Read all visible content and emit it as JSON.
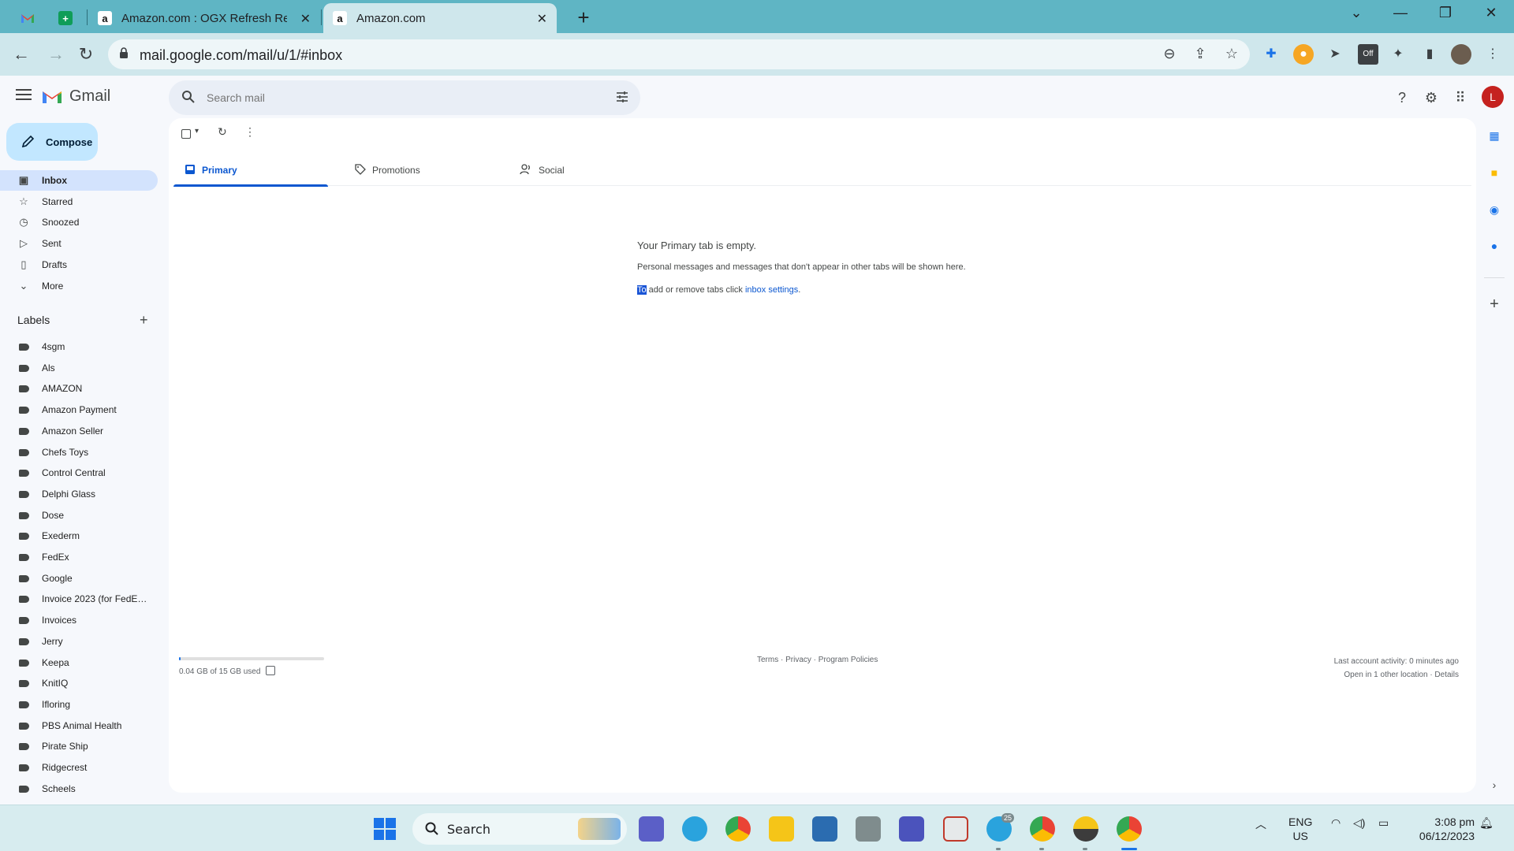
{
  "browser": {
    "tabs": [
      {
        "title": "",
        "favicon": "gmail-icon"
      },
      {
        "title": "",
        "favicon": "sheets-icon"
      },
      {
        "title": "Amazon.com : OGX Refresh Revi",
        "favicon": "amazon-icon"
      },
      {
        "title": "Amazon.com",
        "favicon": "amazon-icon"
      }
    ],
    "url": "mail.google.com/mail/u/1/#inbox"
  },
  "header": {
    "app_name": "Gmail",
    "search_placeholder": "Search mail",
    "avatar_initial": "L"
  },
  "sidebar": {
    "compose_label": "Compose",
    "items": [
      {
        "label": "Inbox",
        "icon": "inbox-icon",
        "active": true
      },
      {
        "label": "Starred",
        "icon": "star-icon"
      },
      {
        "label": "Snoozed",
        "icon": "clock-icon"
      },
      {
        "label": "Sent",
        "icon": "send-icon"
      },
      {
        "label": "Drafts",
        "icon": "draft-icon"
      },
      {
        "label": "More",
        "icon": "chevron-down-icon"
      }
    ],
    "labels_heading": "Labels",
    "labels": [
      "4sgm",
      "Als",
      "AMAZON",
      "Amazon Payment",
      "Amazon Seller",
      "Chefs Toys",
      "Control Central",
      "Delphi Glass",
      "Dose",
      "Exederm",
      "FedEx",
      "Google",
      "Invoice 2023 (for FedEx ...",
      "Invoices",
      "Jerry",
      "Keepa",
      "KnitIQ",
      "Ifloring",
      "PBS Animal Health",
      "Pirate Ship",
      "Ridgecrest",
      "Scheels"
    ]
  },
  "main": {
    "tabs": [
      {
        "label": "Primary",
        "icon": "inbox-icon",
        "active": true
      },
      {
        "label": "Promotions",
        "icon": "tag-icon"
      },
      {
        "label": "Social",
        "icon": "people-icon"
      }
    ],
    "empty_title": "Your Primary tab is empty.",
    "empty_sub": "Personal messages and messages that don't appear in other tabs will be shown here.",
    "empty_hint_selected": "To",
    "empty_hint_text": " add or remove tabs click ",
    "empty_hint_link": "inbox settings",
    "empty_hint_end": ".",
    "storage_text": "0.04 GB of 15 GB used",
    "storage_fraction": 0.003,
    "footer_links": "Terms · Privacy · Program Policies",
    "activity_line1": "Last account activity: 0 minutes ago",
    "activity_line2": "Open in 1 other location · Details"
  },
  "taskbar": {
    "search_label": "Search",
    "telegram_badge": "25",
    "lang_line1": "ENG",
    "lang_line2": "US",
    "time": "3:08 pm",
    "date": "06/12/2023"
  },
  "colors": {
    "tabstrip": "#5fb5c4",
    "toolbar": "#cfe7ec",
    "accent": "#0b57d0",
    "compose": "#c2e7ff",
    "inbox_active": "#d3e3fd",
    "avatar": "#c5221f"
  }
}
